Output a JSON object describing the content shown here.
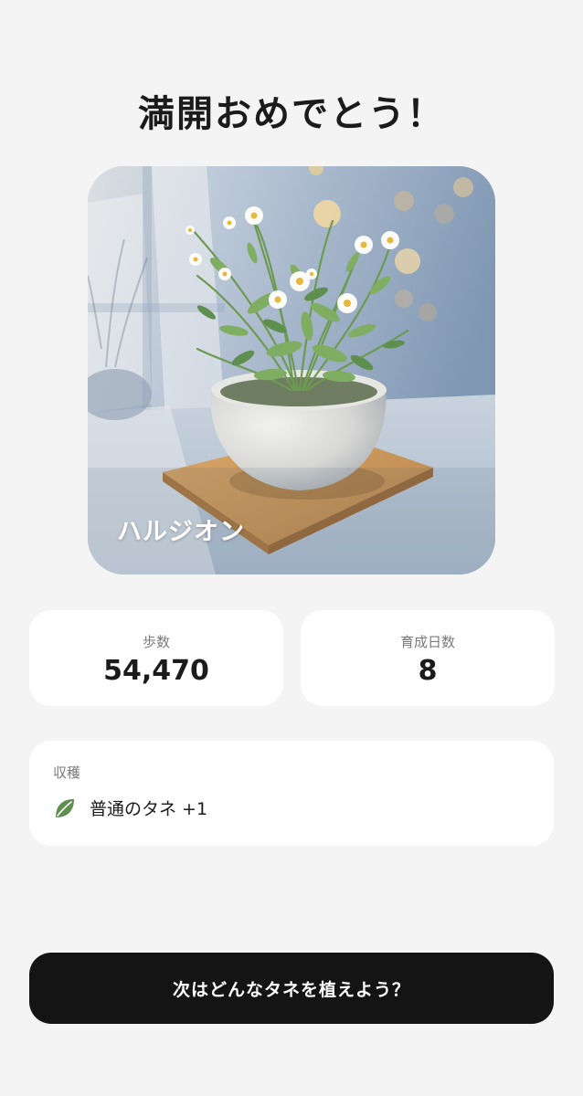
{
  "header": {
    "title": "満開おめでとう！"
  },
  "plant": {
    "name": "ハルジオン",
    "image_icon": "potted-daisy-plant"
  },
  "stats": {
    "steps": {
      "label": "歩数",
      "value": "54,470"
    },
    "days": {
      "label": "育成日数",
      "value": "8"
    }
  },
  "harvest": {
    "label": "収穫",
    "item_icon": "leaf-icon",
    "item": "普通のタネ +1"
  },
  "cta": {
    "label": "次はどんなタネを植えよう？"
  },
  "colors": {
    "background": "#f4f4f4",
    "card": "#ffffff",
    "button": "#141414",
    "leaf": "#5f8f4e"
  }
}
